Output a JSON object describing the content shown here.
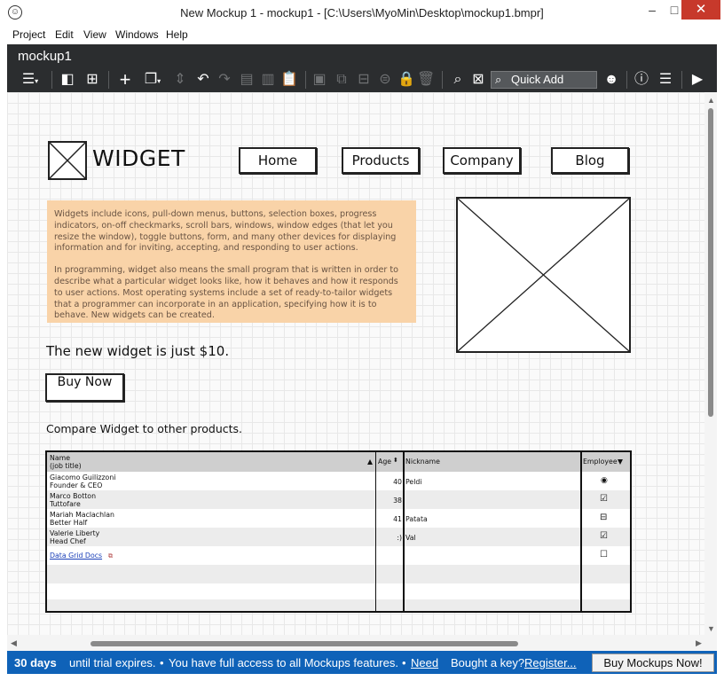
{
  "window": {
    "title": "New Mockup 1 - mockup1 - [C:\\Users\\MyoMin\\Desktop\\mockup1.bmpr]",
    "minimize": "–",
    "maximize": "□",
    "close": "✕"
  },
  "menu": [
    "Project",
    "Edit",
    "View",
    "Windows",
    "Help"
  ],
  "toolbar": {
    "tab_title": "mockup1",
    "quick_add_placeholder": "Quick Add"
  },
  "mockup": {
    "logo_text": "WIDGET",
    "nav": [
      "Home",
      "Products",
      "Company",
      "Blog"
    ],
    "description": [
      "Widgets include icons, pull-down menus, buttons, selection boxes, progress indicators, on-off checkmarks, scroll bars, windows, window edges (that let you resize the window), toggle buttons, form, and many other devices for displaying information and for inviting, accepting, and responding to user actions.",
      "In programming, widget also means the small program that is written in order to describe what a particular widget looks like, how it behaves and how it responds to user actions. Most operating systems include a set of ready-to-tailor widgets that a programmer can incorporate in an application, specifying how it is to behave. New widgets can be created."
    ],
    "price_text": "The new widget is just $10.",
    "buy_button": "Buy Now",
    "compare_text": "Compare Widget to other products."
  },
  "grid": {
    "headers": {
      "name": "Name",
      "name_sub": "(job title)",
      "age": "Age",
      "nickname": "Nickname",
      "employee": "Employee"
    },
    "rows": [
      {
        "name": "Giacomo Guilizzoni",
        "title": "Founder & CEO",
        "age": "40",
        "nickname": "Peldi",
        "employee": "radio"
      },
      {
        "name": "Marco Botton",
        "title": "Tuttofare",
        "age": "38",
        "nickname": "",
        "employee": "checked"
      },
      {
        "name": "Mariah Maclachlan",
        "title": "Better Half",
        "age": "41",
        "nickname": "Patata",
        "employee": "indeterminate"
      },
      {
        "name": "Valerie Liberty",
        "title": "Head Chef",
        "age": ":)",
        "nickname": "Val",
        "employee": "checked"
      }
    ],
    "link_text": "Data Grid Docs",
    "link_row_employee": "unchecked"
  },
  "status": {
    "days": "30 days",
    "trial_text": "until trial expires.",
    "access_text": "You have full access to all Mockups features.",
    "need_link": "Need",
    "key_text": "Bought a key?",
    "register_link": "Register...",
    "buy_button": "Buy Mockups Now!",
    "bullet": "•"
  },
  "colors": {
    "toolbar_bg": "#2b2d2f",
    "status_bg": "#0f62b8",
    "callout_bg": "#f9d3a8",
    "close_btn": "#c7392b"
  }
}
